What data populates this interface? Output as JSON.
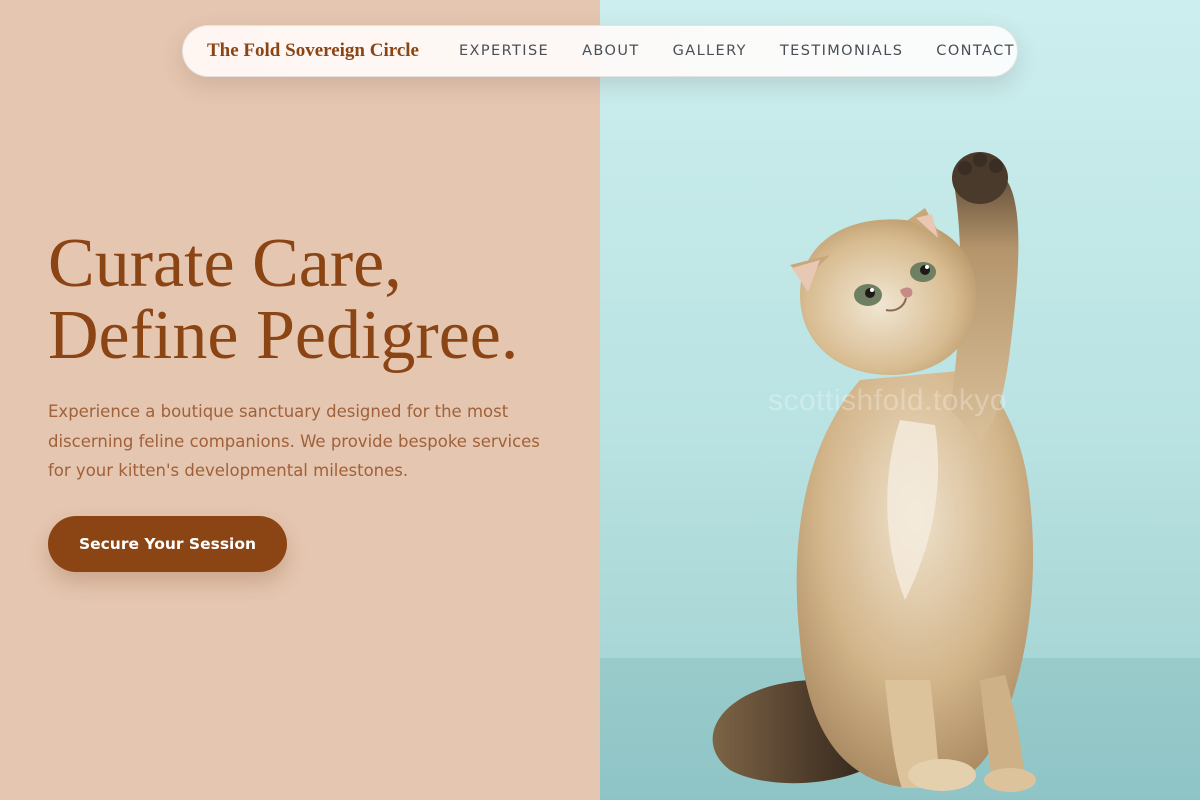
{
  "nav": {
    "brand": "The Fold Sovereign Circle",
    "links": [
      "EXPERTISE",
      "ABOUT",
      "GALLERY",
      "TESTIMONIALS",
      "CONTACT"
    ]
  },
  "hero": {
    "title_line1": "Curate Care,",
    "title_line2": "Define Pedigree.",
    "description": "Experience a boutique sanctuary designed for the most discerning feline companions. We provide bespoke services for your kitten's developmental milestones.",
    "cta_label": "Secure Your Session"
  },
  "image": {
    "watermark": "scottishfold.tokyo"
  },
  "colors": {
    "left_background": "#e5c6b0",
    "right_background": "#c6eaea",
    "brand": "#8b4514",
    "description_text": "#a0613a",
    "nav_text": "#4a4f57",
    "cta_text": "#ffffff"
  }
}
